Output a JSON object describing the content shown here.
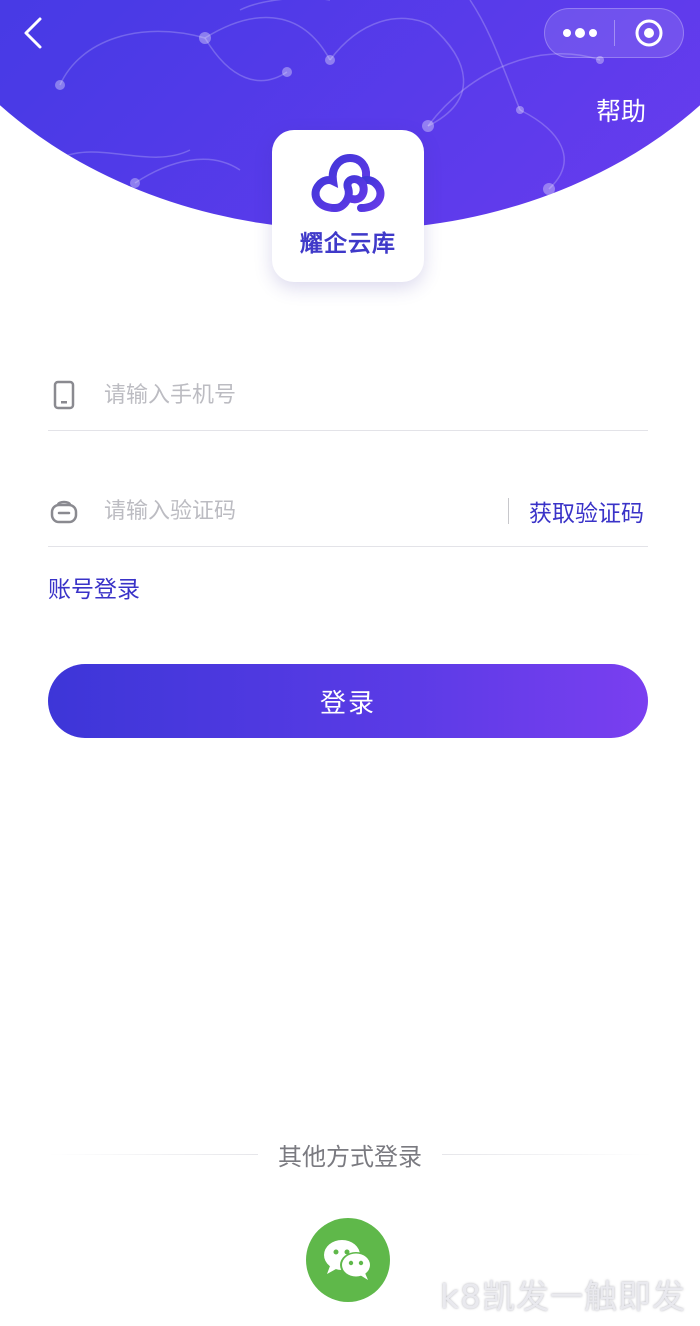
{
  "header": {
    "help_label": "帮助",
    "back_icon": "chevron-left-icon",
    "more_icon": "more-dots-icon",
    "close_icon": "target-circle-icon"
  },
  "brand": {
    "name": "耀企云库",
    "logo_icon": "cloud-link-logo-icon"
  },
  "form": {
    "phone_placeholder": "请输入手机号",
    "phone_icon": "mobile-phone-icon",
    "code_placeholder": "请输入验证码",
    "code_icon": "lock-icon",
    "get_code_label": "获取验证码",
    "account_login_label": "账号登录",
    "login_button_label": "登录"
  },
  "other_login": {
    "label": "其他方式登录",
    "wechat_icon": "wechat-icon"
  },
  "watermark": "k8凯发一触即发",
  "colors": {
    "primary": "#3d36d8",
    "primary_end": "#7a3ff0",
    "link": "#3a33c8",
    "wechat": "#5fb84a"
  }
}
